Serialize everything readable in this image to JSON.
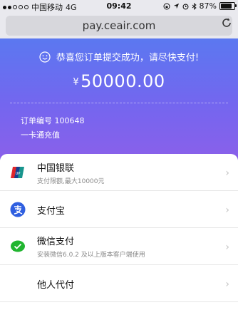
{
  "status": {
    "carrier": "中国移动",
    "network": "4G",
    "time": "09:42",
    "battery_pct": "87%",
    "battery_level": 0.87,
    "signal_bars": 2
  },
  "browser": {
    "url": "pay.ceair.com"
  },
  "hero": {
    "message": "恭喜您订单提交成功，请尽快支付!",
    "currency_symbol": "¥",
    "amount": "50000.00",
    "order_label": "订单编号",
    "order_number": "100648",
    "product": "一卡通充值"
  },
  "payment_methods": [
    {
      "title": "中国银联",
      "subtitle": "支付限额,最大10000元",
      "icon": "unionpay-icon"
    },
    {
      "title": "支付宝",
      "subtitle": "",
      "icon": "alipay-icon"
    },
    {
      "title": "微信支付",
      "subtitle": "安装微信6.0.2 及以上版本客户端使用",
      "icon": "wechat-pay-icon"
    },
    {
      "title": "他人代付",
      "subtitle": "",
      "icon": ""
    }
  ],
  "colors": {
    "hero_top": "#5b78f0",
    "hero_bottom": "#8a60ea",
    "alipay": "#2f5fe0",
    "wechat": "#21b530",
    "unionpay_red": "#e0262b"
  }
}
